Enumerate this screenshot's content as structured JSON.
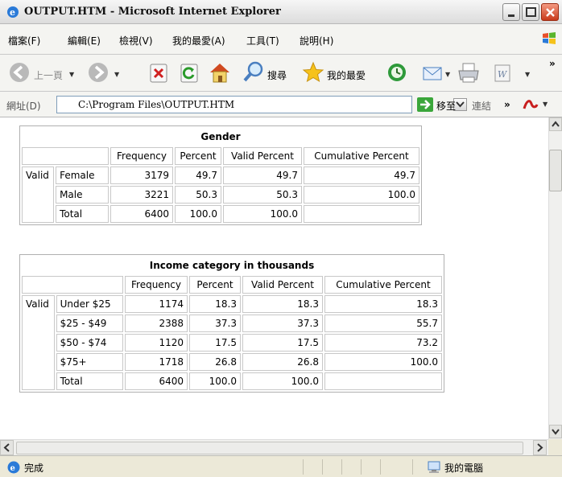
{
  "window": {
    "title": "OUTPUT.HTM - Microsoft Internet Explorer",
    "colors": {
      "chrome": "#ece9d8",
      "close": "#c83a1a",
      "address_border": "#7f9db9"
    }
  },
  "menu": {
    "items": [
      "檔案(F)",
      "編輯(E)",
      "檢視(V)",
      "我的最愛(A)",
      "工具(T)",
      "說明(H)"
    ]
  },
  "toolbar": {
    "back_label": "上一頁",
    "search_label": "搜尋",
    "favorites_label": "我的最愛",
    "overflow": "»"
  },
  "address": {
    "label": "網址(D)",
    "value": "C:\\Program Files\\OUTPUT.HTM",
    "go_label": "移至",
    "links_label": "連結",
    "overflow": "»"
  },
  "tables": {
    "gender": {
      "title": "Gender",
      "headers": [
        "Frequency",
        "Percent",
        "Valid Percent",
        "Cumulative Percent"
      ],
      "group_label": "Valid",
      "rows": [
        {
          "label": "Female",
          "frequency": "3179",
          "percent": "49.7",
          "valid_percent": "49.7",
          "cumulative_percent": "49.7"
        },
        {
          "label": "Male",
          "frequency": "3221",
          "percent": "50.3",
          "valid_percent": "50.3",
          "cumulative_percent": "100.0"
        },
        {
          "label": "Total",
          "frequency": "6400",
          "percent": "100.0",
          "valid_percent": "100.0",
          "cumulative_percent": ""
        }
      ]
    },
    "income": {
      "title": "Income category in thousands",
      "headers": [
        "Frequency",
        "Percent",
        "Valid Percent",
        "Cumulative Percent"
      ],
      "group_label": "Valid",
      "rows": [
        {
          "label": "Under $25",
          "frequency": "1174",
          "percent": "18.3",
          "valid_percent": "18.3",
          "cumulative_percent": "18.3"
        },
        {
          "label": "$25 - $49",
          "frequency": "2388",
          "percent": "37.3",
          "valid_percent": "37.3",
          "cumulative_percent": "55.7"
        },
        {
          "label": "$50 - $74",
          "frequency": "1120",
          "percent": "17.5",
          "valid_percent": "17.5",
          "cumulative_percent": "73.2"
        },
        {
          "label": "$75+",
          "frequency": "1718",
          "percent": "26.8",
          "valid_percent": "26.8",
          "cumulative_percent": "100.0"
        },
        {
          "label": "Total",
          "frequency": "6400",
          "percent": "100.0",
          "valid_percent": "100.0",
          "cumulative_percent": ""
        }
      ]
    }
  },
  "status": {
    "text": "完成",
    "zone": "我的電腦"
  }
}
